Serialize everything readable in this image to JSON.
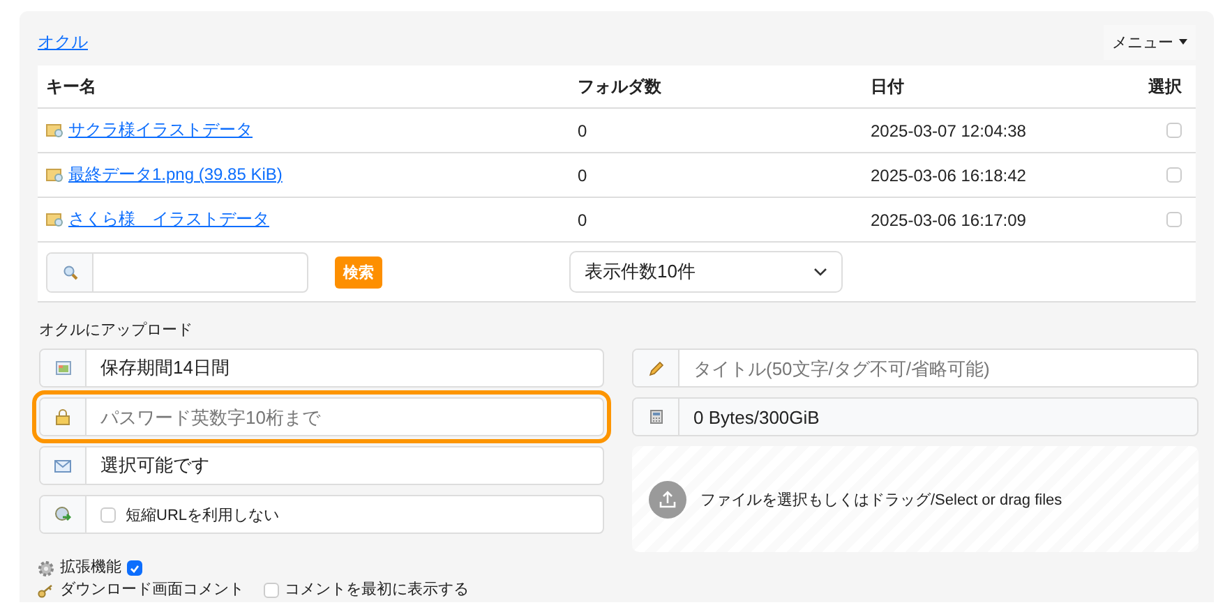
{
  "nav": {
    "link": "オクル",
    "menu": "メニュー"
  },
  "table": {
    "columns": [
      "キー名",
      "フォルダ数",
      "日付",
      "選択"
    ],
    "rows": [
      {
        "name": "サクラ様イラストデータ",
        "folders": "0",
        "date": "2025-03-07 12:04:38",
        "selected": false
      },
      {
        "name": "最終データ1.png (39.85 KiB)",
        "folders": "0",
        "date": "2025-03-06 16:18:42",
        "selected": false
      },
      {
        "name": "さくら様　イラストデータ",
        "folders": "0",
        "date": "2025-03-06 16:17:09",
        "selected": false
      }
    ]
  },
  "search": {
    "button": "検索",
    "per_page": "表示件数10件"
  },
  "upload": {
    "heading": "オクルにアップロード",
    "retention": "保存期間14日間",
    "password": {
      "placeholder": "パスワード英数字10桁まで",
      "focused": true
    },
    "mail": "選択可能です",
    "short_url": {
      "label": "短縮URLを利用しない",
      "checked": false
    },
    "title": {
      "placeholder": "タイトル(50文字/タグ不可/省略可能)"
    },
    "quota": "0 Bytes/300GiB",
    "dropzone": "ファイルを選択もしくはドラッグ/Select or drag files",
    "extensions": {
      "label": "拡張機能",
      "checked": true
    },
    "download_comment": {
      "label": "ダウンロード画面コメント",
      "show_first": {
        "label": "コメントを最初に表示する",
        "checked": false
      }
    }
  }
}
